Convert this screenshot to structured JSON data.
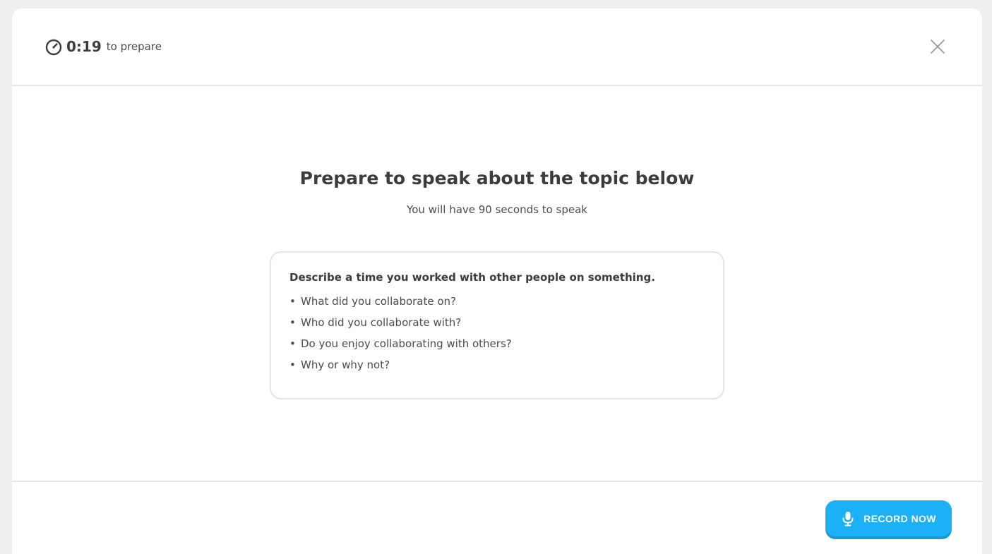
{
  "header": {
    "timer_icon": "stopwatch-icon",
    "timer_value": "0:19",
    "timer_label": "to prepare",
    "close_icon": "close-icon"
  },
  "main": {
    "title": "Prepare to speak about the topic below",
    "subtitle": "You will have 90 seconds to speak",
    "prompt": {
      "question": "Describe a time you worked with other people on something.",
      "bullets": [
        "What did you collaborate on?",
        "Who did you collaborate with?",
        "Do you enjoy collaborating with others?",
        "Why or why not?"
      ]
    }
  },
  "footer": {
    "record_icon": "microphone-icon",
    "record_label": "RECORD NOW"
  },
  "colors": {
    "accent": "#1cb0f6",
    "accent_shadow": "#1899d6",
    "text_dark": "#3c3c3c",
    "text": "#4b4b4b",
    "border": "#e5e5e5",
    "background": "#efefef"
  }
}
